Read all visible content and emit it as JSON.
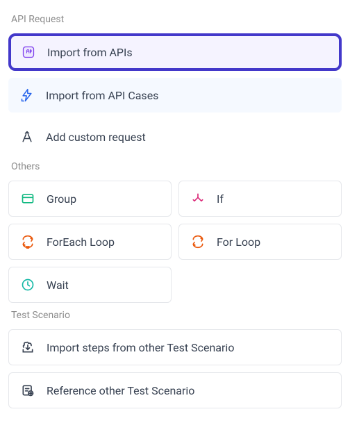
{
  "sections": {
    "api_request": {
      "label": "API Request",
      "items": [
        {
          "label": "Import from APIs"
        },
        {
          "label": "Import from API Cases"
        },
        {
          "label": "Add custom request"
        }
      ]
    },
    "others": {
      "label": "Others",
      "items": [
        {
          "label": "Group"
        },
        {
          "label": "If"
        },
        {
          "label": "ForEach Loop"
        },
        {
          "label": "For Loop"
        },
        {
          "label": "Wait"
        }
      ]
    },
    "test_scenario": {
      "label": "Test Scenario",
      "items": [
        {
          "label": "Import steps from other Test Scenario"
        },
        {
          "label": "Reference other Test Scenario"
        }
      ]
    }
  }
}
